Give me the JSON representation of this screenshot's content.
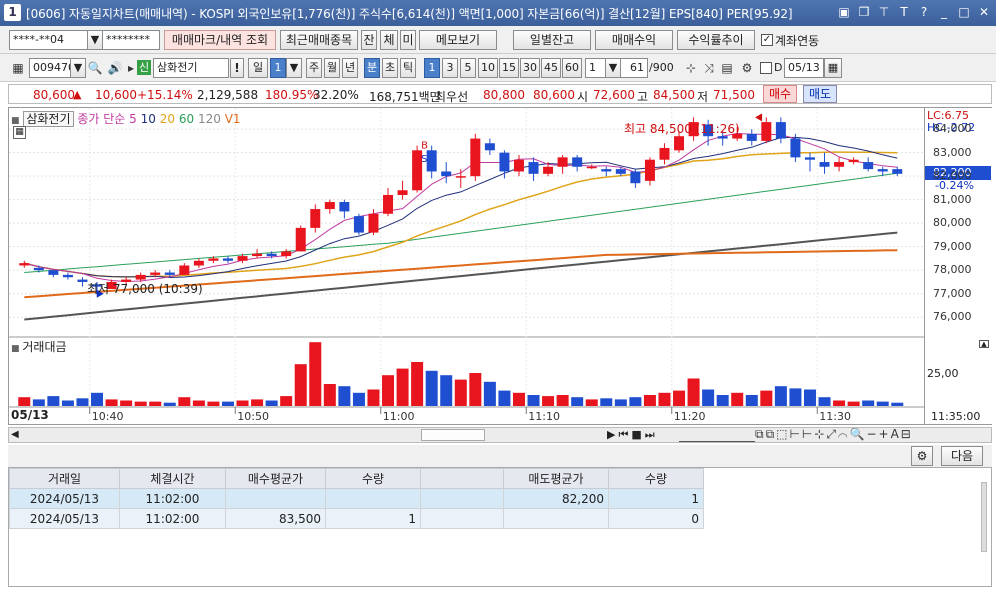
{
  "window": {
    "title": "[0606] 자동일지차트(매매내역) - KOSPI 외국인보유[1,776(천)] 주식수[6,614(천)] 액면[1,000] 자본금[66(억)] 결산[12월] EPS[840] PER[95.92]",
    "icon_label": "1"
  },
  "toolbar1": {
    "account": "****-**04",
    "password": "********",
    "trade_mark_btn": "매매마크/내역 조회",
    "recent_btn": "최근매매종목",
    "chk1": "잔",
    "chk2": "체",
    "chk3": "미",
    "memo_btn": "메모보기",
    "daily_btn": "일별잔고",
    "profit_btn": "매매수익",
    "return_btn": "수익률추이",
    "linked_label": "계좌연동",
    "linked_checked": true
  },
  "toolbar2": {
    "code": "009470",
    "stock_name": "삼화전기",
    "period_day": "일",
    "period_day_val": "1",
    "week": "주",
    "month": "월",
    "year": "년",
    "minute": "분",
    "sec": "초",
    "tick": "틱",
    "minute_opts": [
      "1",
      "3",
      "5",
      "10",
      "15",
      "30",
      "45",
      "60"
    ],
    "min_sel": "1",
    "count": "61",
    "count_total": "/900",
    "d_label": "D",
    "date": "05/13"
  },
  "quote": {
    "price": "80,600",
    "change_arrow": "▲",
    "change": "10,600",
    "pct": "+15.14%",
    "volume": "2,129,588",
    "ratio1": "180.95%",
    "ratio2": "32.20%",
    "amount": "168,751백만",
    "best_label": "최우선",
    "best_sell": "80,800",
    "best_buy": "80,600",
    "open_label": "시",
    "open": "72,600",
    "high_label": "고",
    "high": "84,500",
    "low_label": "저",
    "low": "71,500",
    "buy_btn": "매수",
    "sell_btn": "매도"
  },
  "chart": {
    "name_label": "삼화전기",
    "ma_label": "종가 단순",
    "ma": [
      "5",
      "10",
      "20",
      "60",
      "120"
    ],
    "vol_label": "V1",
    "lc": "LC:6.75",
    "hc": "HC:-2.72",
    "current_price": "82,200",
    "current_pct": "-0.24%",
    "high_note": "최고 84,500 (11:26)",
    "low_note": "최저 77,000 (10:39)",
    "yticks": [
      "84,000",
      "83,000",
      "82,000",
      "81,000",
      "80,000",
      "79,000",
      "78,000",
      "77,000",
      "76,000"
    ],
    "vol_title": "거래대금",
    "vol_tick": "25,00",
    "date_label": "05/13",
    "xticks": [
      "10:40",
      "10:50",
      "11:00",
      "11:10",
      "11:20",
      "11:30"
    ],
    "x_end": "11:35:00",
    "buy_mark": "B",
    "sell_mark": "S",
    "colors": {
      "up": "#e8141e",
      "down": "#1f4fd0",
      "ma5": "#c03aa0",
      "ma10": "#20307a",
      "ma20": "#e0a41a",
      "ma60": "#2aa05a",
      "ma120": "#555555",
      "ma_long": "#e06a1a"
    }
  },
  "chart_data": {
    "type": "candlestick",
    "x_label": "time",
    "candles": [
      {
        "o": 78.2,
        "c": 78.3,
        "h": 78.4,
        "l": 78.1,
        "v": 8
      },
      {
        "o": 78.1,
        "c": 78.0,
        "h": 78.2,
        "l": 77.9,
        "v": 6
      },
      {
        "o": 78.0,
        "c": 77.8,
        "h": 78.0,
        "l": 77.7,
        "v": 9
      },
      {
        "o": 77.8,
        "c": 77.7,
        "h": 77.9,
        "l": 77.6,
        "v": 5
      },
      {
        "o": 77.6,
        "c": 77.5,
        "h": 77.7,
        "l": 77.3,
        "v": 7
      },
      {
        "o": 77.4,
        "c": 77.3,
        "h": 77.5,
        "l": 77.0,
        "v": 12
      },
      {
        "o": 77.2,
        "c": 77.5,
        "h": 77.6,
        "l": 77.2,
        "v": 6
      },
      {
        "o": 77.5,
        "c": 77.6,
        "h": 77.7,
        "l": 77.4,
        "v": 5
      },
      {
        "o": 77.6,
        "c": 77.8,
        "h": 77.9,
        "l": 77.5,
        "v": 4
      },
      {
        "o": 77.8,
        "c": 77.9,
        "h": 78.0,
        "l": 77.7,
        "v": 4
      },
      {
        "o": 77.9,
        "c": 77.8,
        "h": 78.0,
        "l": 77.7,
        "v": 3
      },
      {
        "o": 77.8,
        "c": 78.2,
        "h": 78.3,
        "l": 77.8,
        "v": 8
      },
      {
        "o": 78.2,
        "c": 78.4,
        "h": 78.5,
        "l": 78.1,
        "v": 5
      },
      {
        "o": 78.4,
        "c": 78.5,
        "h": 78.6,
        "l": 78.3,
        "v": 4
      },
      {
        "o": 78.5,
        "c": 78.4,
        "h": 78.6,
        "l": 78.3,
        "v": 4
      },
      {
        "o": 78.4,
        "c": 78.6,
        "h": 78.7,
        "l": 78.3,
        "v": 5
      },
      {
        "o": 78.6,
        "c": 78.7,
        "h": 78.9,
        "l": 78.5,
        "v": 6
      },
      {
        "o": 78.7,
        "c": 78.6,
        "h": 78.8,
        "l": 78.5,
        "v": 5
      },
      {
        "o": 78.6,
        "c": 78.8,
        "h": 78.9,
        "l": 78.5,
        "v": 9
      },
      {
        "o": 78.8,
        "c": 79.8,
        "h": 79.9,
        "l": 78.8,
        "v": 38
      },
      {
        "o": 79.8,
        "c": 80.6,
        "h": 80.8,
        "l": 79.6,
        "v": 58
      },
      {
        "o": 80.6,
        "c": 80.9,
        "h": 81.0,
        "l": 80.4,
        "v": 20
      },
      {
        "o": 80.9,
        "c": 80.5,
        "h": 81.0,
        "l": 80.2,
        "v": 18
      },
      {
        "o": 80.3,
        "c": 79.6,
        "h": 80.4,
        "l": 79.5,
        "v": 12
      },
      {
        "o": 79.6,
        "c": 80.4,
        "h": 80.6,
        "l": 79.5,
        "v": 15
      },
      {
        "o": 80.4,
        "c": 81.2,
        "h": 81.5,
        "l": 80.3,
        "v": 28
      },
      {
        "o": 81.2,
        "c": 81.4,
        "h": 81.8,
        "l": 81.0,
        "v": 34
      },
      {
        "o": 81.4,
        "c": 83.1,
        "h": 83.3,
        "l": 81.3,
        "v": 40
      },
      {
        "o": 83.1,
        "c": 82.2,
        "h": 83.3,
        "l": 81.9,
        "v": 32
      },
      {
        "o": 82.2,
        "c": 82.0,
        "h": 82.6,
        "l": 81.7,
        "v": 28
      },
      {
        "o": 82.0,
        "c": 82.0,
        "h": 82.3,
        "l": 81.5,
        "v": 24
      },
      {
        "o": 82.0,
        "c": 83.6,
        "h": 83.8,
        "l": 81.8,
        "v": 30
      },
      {
        "o": 83.4,
        "c": 83.1,
        "h": 83.6,
        "l": 82.9,
        "v": 22
      },
      {
        "o": 83.0,
        "c": 82.2,
        "h": 83.1,
        "l": 81.9,
        "v": 14
      },
      {
        "o": 82.2,
        "c": 82.7,
        "h": 82.9,
        "l": 82.0,
        "v": 12
      },
      {
        "o": 82.6,
        "c": 82.1,
        "h": 82.8,
        "l": 81.8,
        "v": 10
      },
      {
        "o": 82.1,
        "c": 82.4,
        "h": 82.6,
        "l": 82.0,
        "v": 9
      },
      {
        "o": 82.4,
        "c": 82.8,
        "h": 82.9,
        "l": 82.1,
        "v": 10
      },
      {
        "o": 82.8,
        "c": 82.4,
        "h": 82.9,
        "l": 82.2,
        "v": 8
      },
      {
        "o": 82.4,
        "c": 82.4,
        "h": 82.5,
        "l": 82.3,
        "v": 6
      },
      {
        "o": 82.3,
        "c": 82.2,
        "h": 82.4,
        "l": 82.0,
        "v": 7
      },
      {
        "o": 82.3,
        "c": 82.1,
        "h": 82.4,
        "l": 82.0,
        "v": 6
      },
      {
        "o": 82.2,
        "c": 81.7,
        "h": 82.3,
        "l": 81.5,
        "v": 8
      },
      {
        "o": 81.8,
        "c": 82.7,
        "h": 82.8,
        "l": 81.6,
        "v": 10
      },
      {
        "o": 82.7,
        "c": 83.2,
        "h": 83.4,
        "l": 82.5,
        "v": 12
      },
      {
        "o": 83.1,
        "c": 83.7,
        "h": 83.9,
        "l": 83.0,
        "v": 14
      },
      {
        "o": 83.7,
        "c": 84.3,
        "h": 84.5,
        "l": 83.5,
        "v": 25
      },
      {
        "o": 84.2,
        "c": 83.7,
        "h": 84.4,
        "l": 83.3,
        "v": 15
      },
      {
        "o": 83.7,
        "c": 83.6,
        "h": 83.9,
        "l": 83.3,
        "v": 10
      },
      {
        "o": 83.6,
        "c": 83.8,
        "h": 84.1,
        "l": 83.5,
        "v": 12
      },
      {
        "o": 83.8,
        "c": 83.5,
        "h": 84.0,
        "l": 83.3,
        "v": 10
      },
      {
        "o": 83.5,
        "c": 84.3,
        "h": 84.5,
        "l": 83.4,
        "v": 14
      },
      {
        "o": 84.3,
        "c": 83.6,
        "h": 84.5,
        "l": 83.4,
        "v": 18
      },
      {
        "o": 83.6,
        "c": 82.8,
        "h": 83.8,
        "l": 82.6,
        "v": 16
      },
      {
        "o": 82.8,
        "c": 82.7,
        "h": 83.0,
        "l": 82.2,
        "v": 15
      },
      {
        "o": 82.6,
        "c": 82.4,
        "h": 83.0,
        "l": 82.1,
        "v": 8
      },
      {
        "o": 82.4,
        "c": 82.6,
        "h": 82.8,
        "l": 82.2,
        "v": 5
      },
      {
        "o": 82.6,
        "c": 82.7,
        "h": 82.8,
        "l": 82.5,
        "v": 4
      },
      {
        "o": 82.6,
        "c": 82.3,
        "h": 82.8,
        "l": 82.2,
        "v": 5
      },
      {
        "o": 82.3,
        "c": 82.2,
        "h": 82.4,
        "l": 82.0,
        "v": 4
      },
      {
        "o": 82.3,
        "c": 82.1,
        "h": 82.4,
        "l": 82.0,
        "v": 3
      }
    ],
    "ylim": [
      75.2,
      84.9
    ]
  },
  "tabs2": {
    "next_btn": "다음"
  },
  "trades": {
    "headers": [
      "거래일",
      "체결시간",
      "매수평균가",
      "수량",
      "",
      "매도평균가",
      "수량"
    ],
    "rows": [
      [
        "2024/05/13",
        "11:02:00",
        "",
        "",
        "",
        "82,200",
        "1"
      ],
      [
        "2024/05/13",
        "11:02:00",
        "83,500",
        "1",
        "",
        "",
        "0"
      ]
    ]
  }
}
